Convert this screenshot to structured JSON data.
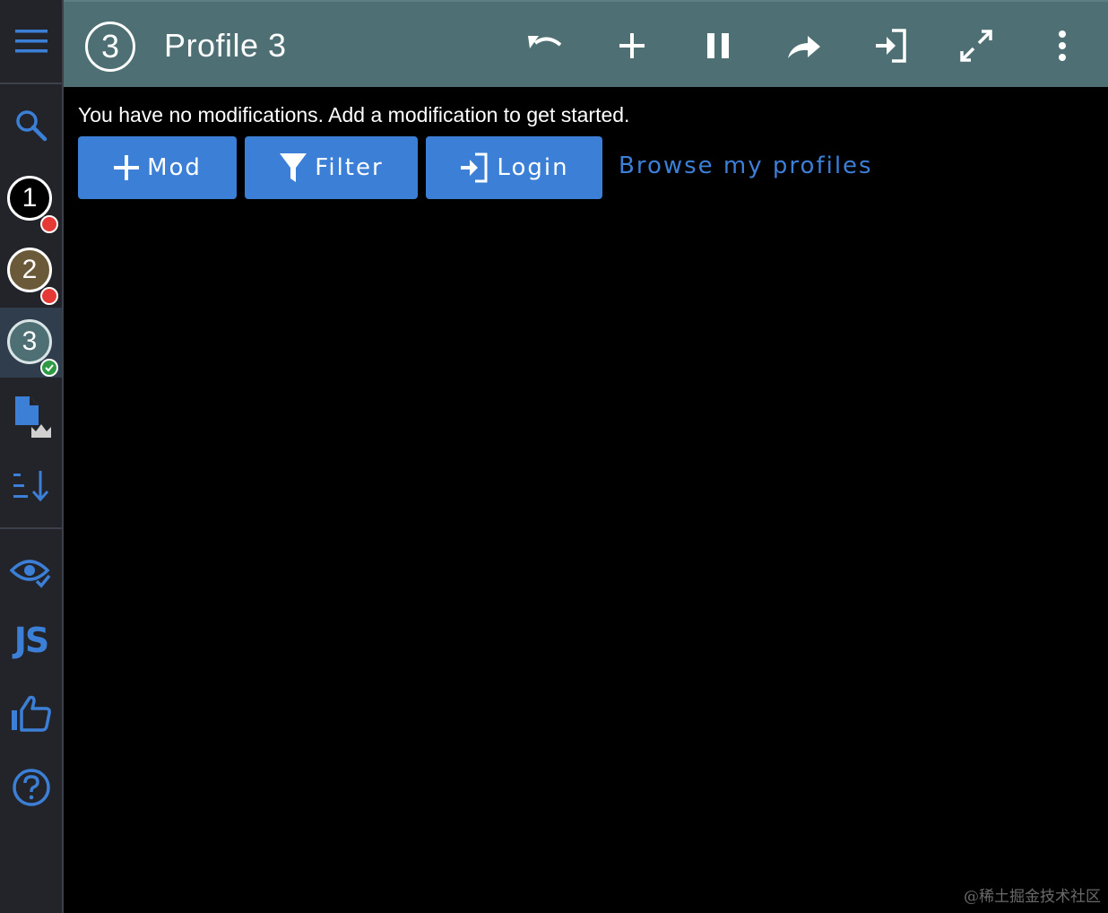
{
  "sidebar": {
    "profiles": [
      {
        "number": "1",
        "status": "error",
        "color": "#000000"
      },
      {
        "number": "2",
        "status": "error",
        "color": "#6b5a3a"
      },
      {
        "number": "3",
        "status": "active",
        "color": "#4e6f73"
      }
    ],
    "icons": [
      "menu-icon",
      "search-icon",
      "file-crown-icon",
      "sort-icon",
      "eye-check-icon",
      "js-icon",
      "thumbs-up-icon",
      "help-icon"
    ],
    "js_label": "JS"
  },
  "header": {
    "profile_number": "3",
    "title": "Profile 3",
    "actions": [
      "undo-icon",
      "plus-icon",
      "pause-icon",
      "share-icon",
      "login-icon",
      "expand-icon",
      "more-vertical-icon"
    ]
  },
  "main": {
    "message": "You have no modifications. Add a modification to get started.",
    "mod_label": "Mod",
    "filter_label": "Filter",
    "login_label": "Login",
    "browse_link": "Browse my profiles"
  },
  "watermark": "@稀土掘金技术社区",
  "colors": {
    "accent": "#3c7fd6",
    "header_bg": "#4e6f73",
    "sidebar_bg": "#22242a",
    "error_badge": "#e53935",
    "success_badge": "#2e9a46"
  }
}
